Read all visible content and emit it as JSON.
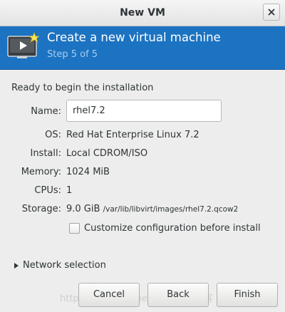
{
  "window": {
    "title": "New VM"
  },
  "banner": {
    "title": "Create a new virtual machine",
    "step": "Step 5 of 5"
  },
  "summary": {
    "heading": "Ready to begin the installation",
    "name_label": "Name:",
    "name_value": "rhel7.2",
    "os_label": "OS:",
    "os_value": "Red Hat Enterprise Linux 7.2",
    "install_label": "Install:",
    "install_value": "Local CDROM/ISO",
    "memory_label": "Memory:",
    "memory_value": "1024 MiB",
    "cpus_label": "CPUs:",
    "cpus_value": "1",
    "storage_label": "Storage:",
    "storage_value": "9.0 GiB",
    "storage_path": "/var/lib/libvirt/images/rhel7.2.qcow2",
    "customize_label": "Customize configuration before install",
    "customize_checked": false
  },
  "network": {
    "expander_label": "Network selection"
  },
  "buttons": {
    "cancel": "Cancel",
    "back": "Back",
    "finish": "Finish"
  },
  "watermark": "http://blog.csdn.net/@51CTO博客",
  "colors": {
    "banner": "#1c73c1",
    "step_text": "#a6cdf2"
  }
}
